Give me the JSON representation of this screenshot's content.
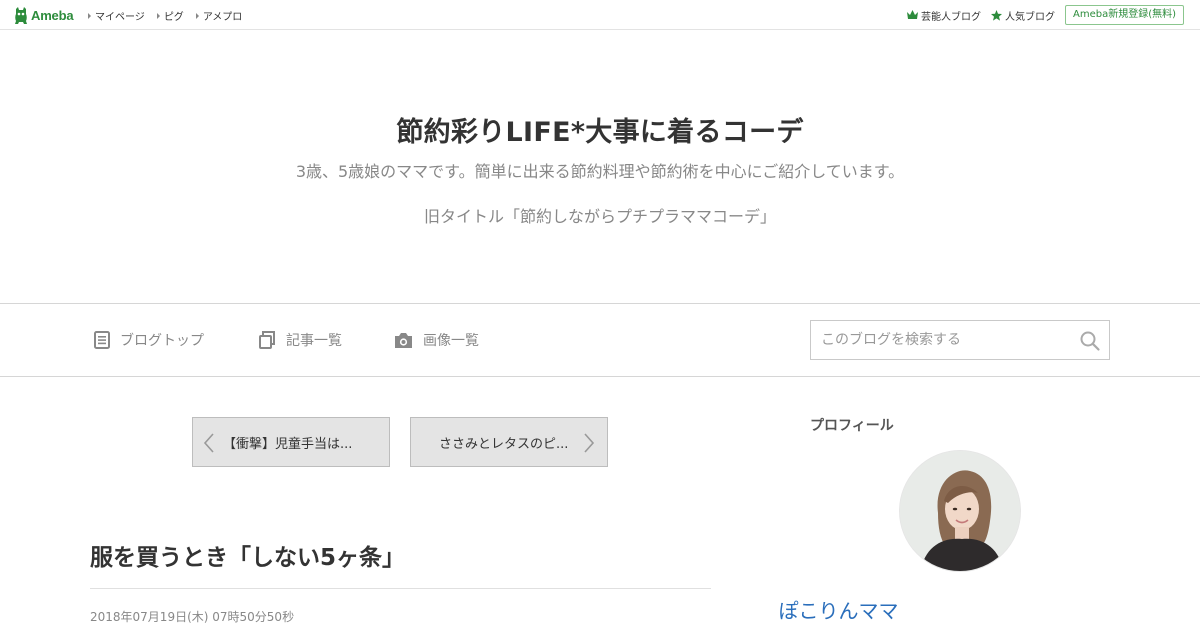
{
  "global_nav": {
    "logo_text": "Ameba",
    "links": [
      "マイページ",
      "ピグ",
      "アメプロ"
    ],
    "right_links": [
      {
        "label": "芸能人ブログ",
        "icon": "crown-icon"
      },
      {
        "label": "人気ブログ",
        "icon": "star-icon"
      }
    ],
    "signup_label": "Ameba新規登録(無料)",
    "brand_color": "#2d8c3c"
  },
  "header": {
    "title": "節約彩りLIFE*大事に着るコーデ",
    "description": "3歳、5歳娘のママです。簡単に出来る節約料理や節約術を中心にご紹介しています。",
    "subtitle": "旧タイトル「節約しながらプチプラママコーデ」"
  },
  "blog_nav": {
    "items": [
      {
        "label": "ブログトップ",
        "icon": "document-icon"
      },
      {
        "label": "記事一覧",
        "icon": "copy-icon"
      },
      {
        "label": "画像一覧",
        "icon": "camera-icon"
      }
    ],
    "search_placeholder": "このブログを検索する"
  },
  "pager": {
    "prev_label": "【衝撃】児童手当は...",
    "next_label": "ささみとレタスのピ..."
  },
  "article": {
    "title": "服を買うとき「しない5ヶ条」",
    "date": "2018年07月19日(木) 07時50分50秒"
  },
  "sidebar": {
    "profile_heading": "プロフィール",
    "profile_name": "ぽこりんママ"
  }
}
